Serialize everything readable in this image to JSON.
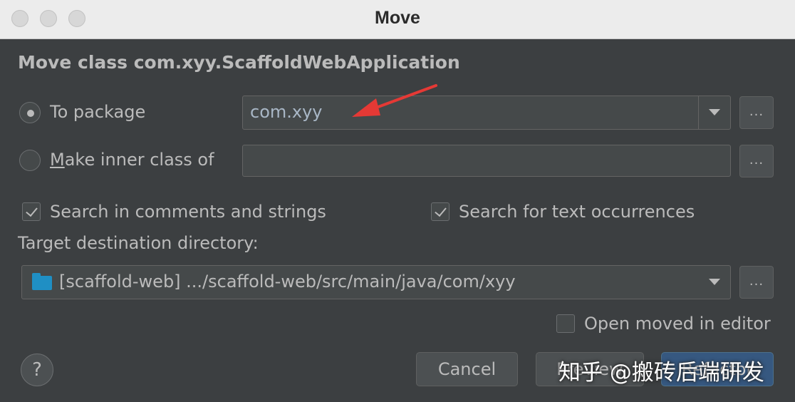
{
  "window": {
    "title": "Move"
  },
  "dialog": {
    "heading": "Move class com.xyy.ScaffoldWebApplication",
    "to_package": {
      "label": "To package",
      "selected": true,
      "value": "com.xyy"
    },
    "inner_class": {
      "label_underlined": "M",
      "label_rest": "ake inner class of",
      "selected": false,
      "value": ""
    },
    "browse_label": "...",
    "search_comments": {
      "label": "Search in comments and strings",
      "checked": true
    },
    "search_text": {
      "label": "Search for text occurrences",
      "checked": true
    },
    "target_dir": {
      "label": "Target destination directory:",
      "value": "[scaffold-web] .../scaffold-web/src/main/java/com/xyy",
      "icon": "folder-icon"
    },
    "open_in_editor": {
      "label": "Open moved in editor",
      "checked": false
    },
    "help_label": "?",
    "buttons": {
      "cancel": "Cancel",
      "preview": "Preview",
      "refactor": "Refactor"
    }
  },
  "watermark": "知乎 @搬砖后端研发",
  "colors": {
    "background": "#3c3f41",
    "text": "#bbbbbb",
    "accent": "#365880",
    "folder": "#1f8fc4",
    "annotation": "#e53935"
  }
}
